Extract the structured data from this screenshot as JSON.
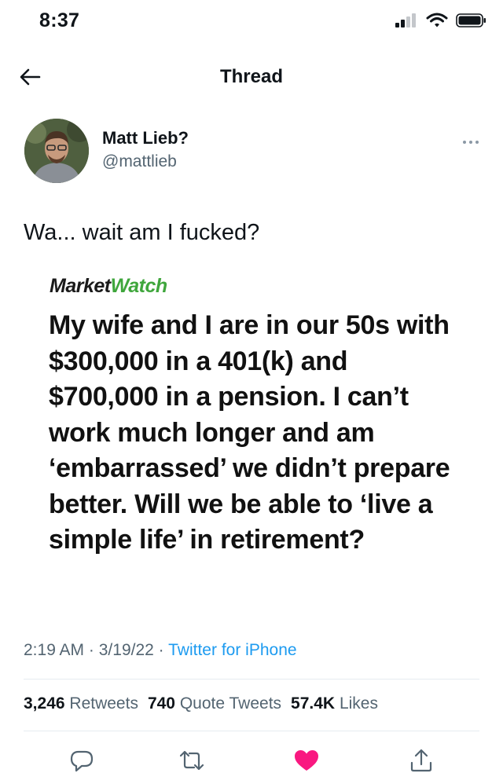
{
  "status_bar": {
    "time": "8:37"
  },
  "nav": {
    "title": "Thread"
  },
  "tweet": {
    "author_name": "Matt Lieb?",
    "author_handle": "@mattlieb",
    "text": "Wa... wait am I fucked?",
    "image_card": {
      "source_logo_part1": "Market",
      "source_logo_part2": "Watch",
      "headline": "My wife and I are in our 50s with $300,000 in a 401(k) and $700,000 in a pension. I can’t work much longer and am ‘embarrassed’ we didn’t prepare better. Will we be able to ‘live a simple life’ in retirement?"
    },
    "time": "2:19 AM",
    "date": "3/19/22",
    "separator": "·",
    "source": "Twitter for iPhone",
    "stats": {
      "retweets_count": "3,246",
      "retweets_label": "Retweets",
      "quote_tweets_count": "740",
      "quote_tweets_label": "Quote Tweets",
      "likes_count": "57.4K",
      "likes_label": "Likes"
    }
  },
  "icons": {
    "back": "arrow-left-icon",
    "reply": "reply-icon",
    "retweet": "retweet-icon",
    "like": "heart-icon",
    "share": "share-icon",
    "more": "more-icon"
  },
  "colors": {
    "accent": "#1d9bf0",
    "like": "#f91880",
    "marketwatch_green": "#3fa63c",
    "secondary_text": "#536471"
  }
}
